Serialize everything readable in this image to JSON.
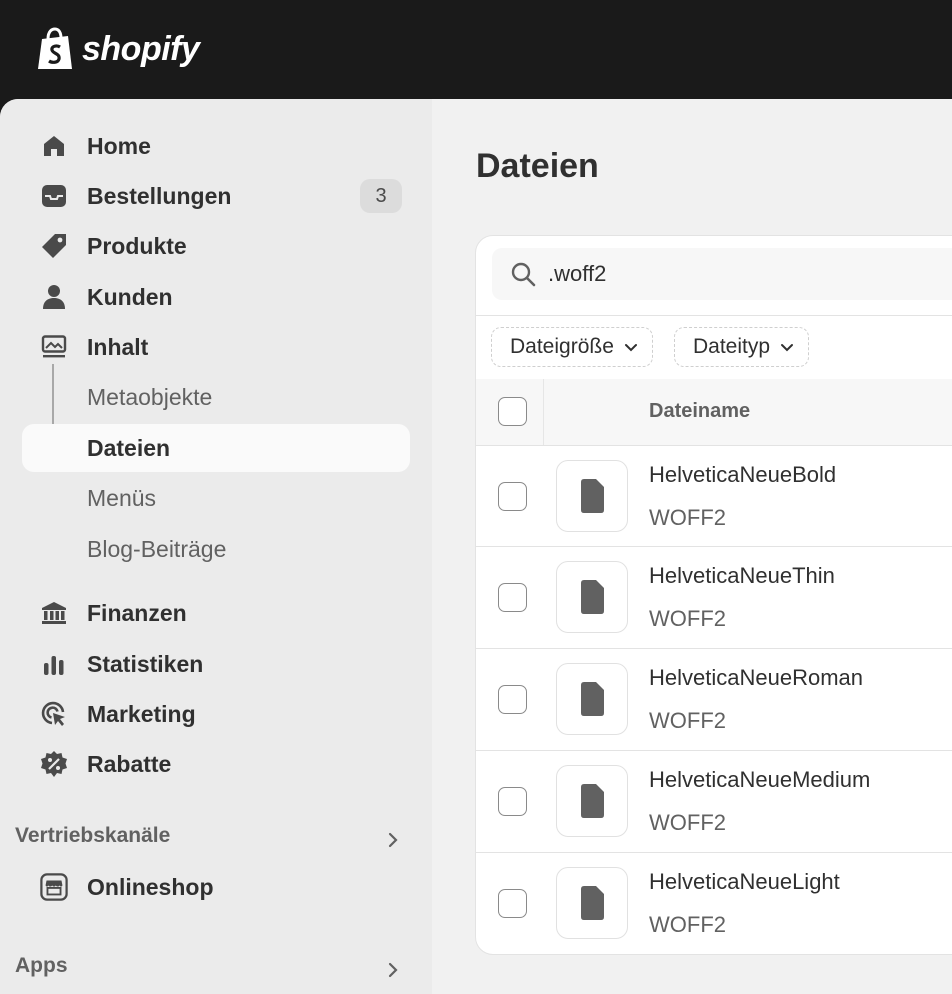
{
  "brand": {
    "name": "shopify"
  },
  "sidebar": {
    "items": [
      {
        "label": "Home",
        "icon": "home-icon"
      },
      {
        "label": "Bestellungen",
        "icon": "inbox-icon",
        "badge": "3"
      },
      {
        "label": "Produkte",
        "icon": "tag-icon"
      },
      {
        "label": "Kunden",
        "icon": "person-icon"
      },
      {
        "label": "Inhalt",
        "icon": "content-icon"
      },
      {
        "label": "Metaobjekte"
      },
      {
        "label": "Dateien"
      },
      {
        "label": "Menüs"
      },
      {
        "label": "Blog-Beiträge"
      },
      {
        "label": "Finanzen",
        "icon": "bank-icon"
      },
      {
        "label": "Statistiken",
        "icon": "bar-chart-icon"
      },
      {
        "label": "Marketing",
        "icon": "target-icon"
      },
      {
        "label": "Rabatte",
        "icon": "discount-icon"
      }
    ],
    "sales_channels": {
      "title": "Vertriebskanäle",
      "items": [
        {
          "label": "Onlineshop",
          "icon": "store-icon"
        }
      ]
    },
    "apps": {
      "title": "Apps"
    }
  },
  "main": {
    "title": "Dateien",
    "search": {
      "value": ".woff2"
    },
    "filters": [
      {
        "label": "Dateigröße"
      },
      {
        "label": "Dateityp"
      }
    ],
    "table": {
      "column": "Dateiname",
      "rows": [
        {
          "name": "HelveticaNeueBold",
          "type": "WOFF2"
        },
        {
          "name": "HelveticaNeueThin",
          "type": "WOFF2"
        },
        {
          "name": "HelveticaNeueRoman",
          "type": "WOFF2"
        },
        {
          "name": "HelveticaNeueMedium",
          "type": "WOFF2"
        },
        {
          "name": "HelveticaNeueLight",
          "type": "WOFF2"
        }
      ]
    }
  }
}
